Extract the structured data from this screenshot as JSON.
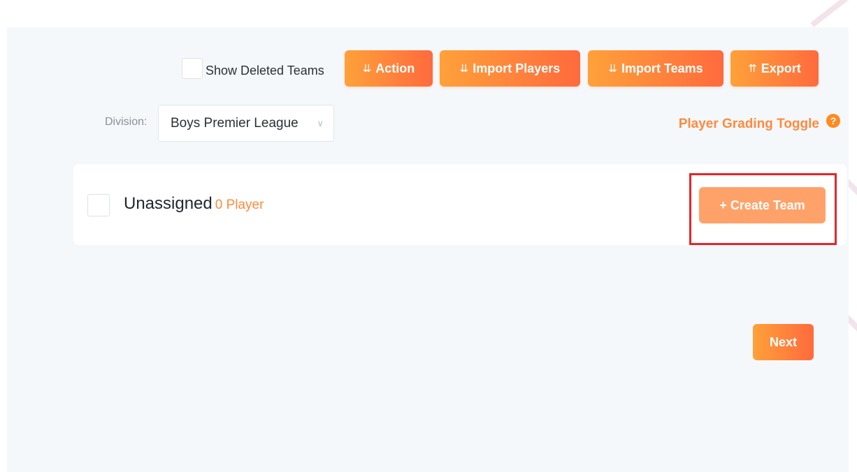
{
  "toolbar": {
    "show_deleted_label": "Show Deleted Teams",
    "action_label": "Action",
    "import_players_label": "Import Players",
    "import_teams_label": "Import Teams",
    "export_label": "Export",
    "expand_icon": "≫",
    "collapse_icon": "≪"
  },
  "filters": {
    "division_label": "Division:",
    "division_value": "Boys Premier League",
    "grading_toggle_label": "Player Grading Toggle",
    "help_icon_glyph": "?"
  },
  "team_card": {
    "name": "Unassigned",
    "count": "0 Player",
    "create_label": "+ Create Team"
  },
  "footer": {
    "next_label": "Next"
  },
  "colors": {
    "accent": "#ff8a3d",
    "gradient_start": "#ffa13a",
    "gradient_end": "#ff6a3d",
    "highlight": "#e4262a",
    "page_bg": "#f5f8fb"
  }
}
